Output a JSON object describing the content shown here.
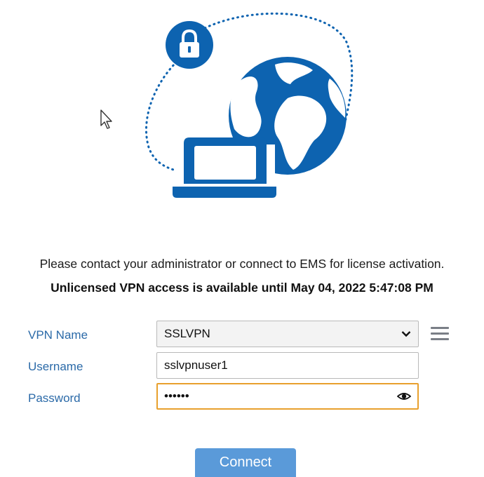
{
  "illustration": {
    "icons": [
      "lock-icon",
      "globe-icon",
      "laptop-icon"
    ],
    "accent_color": "#0d63b0"
  },
  "messages": {
    "notice": "Please contact your administrator or connect to EMS for license activation.",
    "license": "Unlicensed VPN access is available until May 04, 2022 5:47:08 PM"
  },
  "form": {
    "vpn_name": {
      "label": "VPN Name",
      "selected": "SSLVPN"
    },
    "username": {
      "label": "Username",
      "value": "sslvpnuser1"
    },
    "password": {
      "label": "Password",
      "masked_value": "••••••"
    },
    "label_color": "#2b6aa8",
    "focus_color": "#e8a02d"
  },
  "buttons": {
    "connect_label": "Connect",
    "connect_color": "#5a9ad9"
  }
}
